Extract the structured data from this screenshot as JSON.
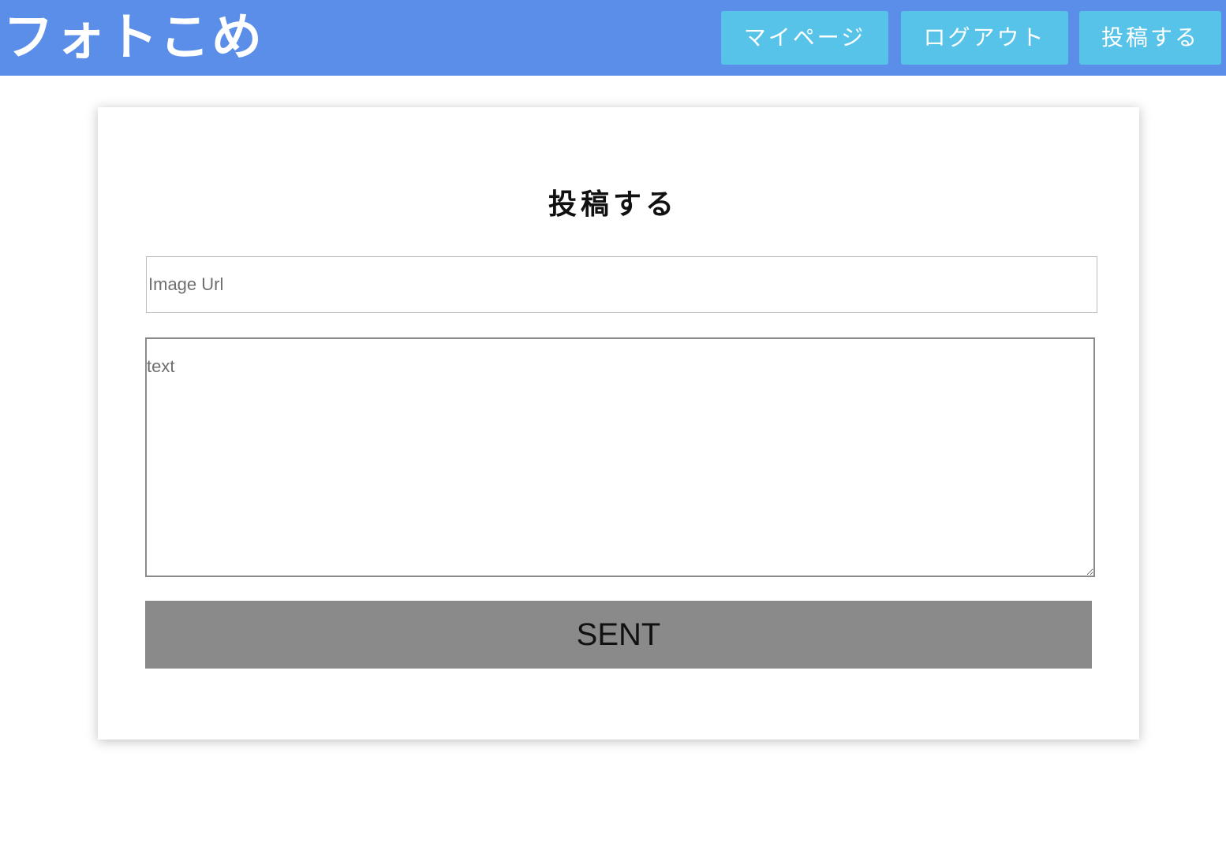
{
  "header": {
    "logo": "フォトこめ",
    "nav": {
      "mypage_label": "マイページ",
      "logout_label": "ログアウト",
      "post_label": "投稿する"
    },
    "colors": {
      "background": "#5b8ee8",
      "button": "#58c3e8"
    }
  },
  "form": {
    "title": "投稿する",
    "image_url": {
      "value": "",
      "placeholder": "Image Url"
    },
    "text": {
      "value": "",
      "placeholder": "text"
    },
    "submit_label": "SENT"
  }
}
